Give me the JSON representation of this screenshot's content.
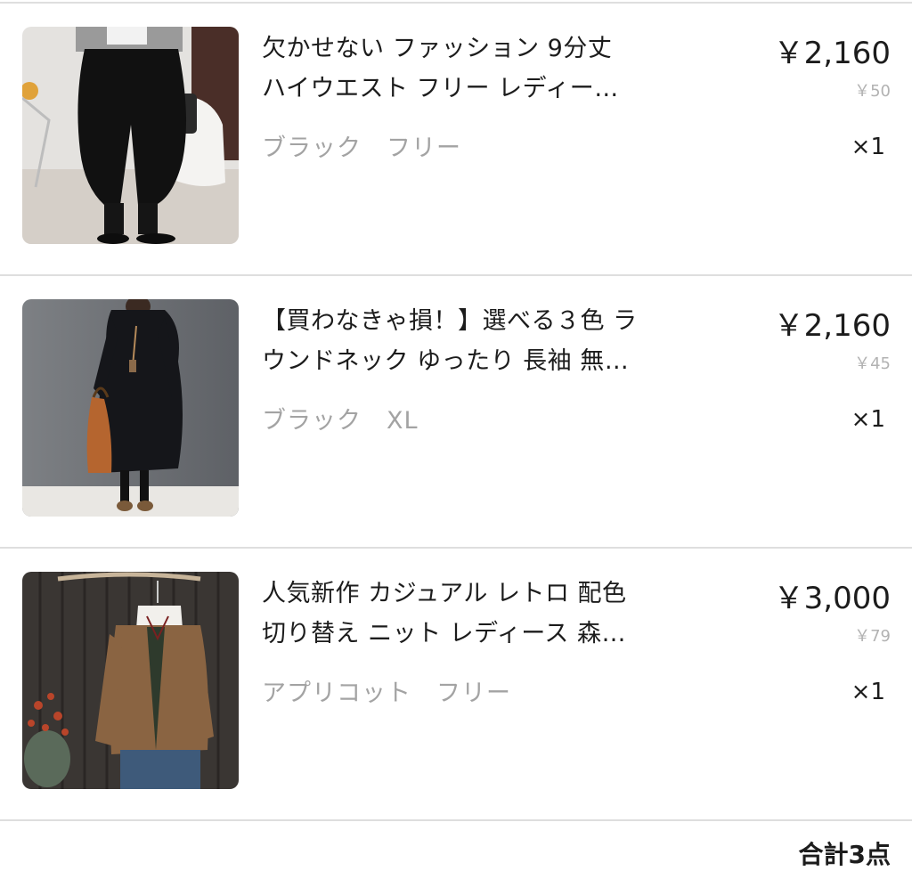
{
  "cart": {
    "items": [
      {
        "title_line1": "欠かせない ファッション 9分丈",
        "title_line2": "ハイウエスト フリー レディー…",
        "color": "ブラック",
        "size": "フリー",
        "price": "￥2,160",
        "points": "￥50",
        "quantity": "×1"
      },
      {
        "title_line1": "【買わなきゃ損！】選べる３色 ラ",
        "title_line2": "ウンドネック ゆったり 長袖 無…",
        "color": "ブラック",
        "size": "XL",
        "price": "￥2,160",
        "points": "￥45",
        "quantity": "×1"
      },
      {
        "title_line1": "人気新作 カジュアル レトロ 配色",
        "title_line2": "切り替え ニット レディース 森…",
        "color": "アプリコット",
        "size": "フリー",
        "price": "￥3,000",
        "points": "￥79",
        "quantity": "×1"
      }
    ],
    "total_label": "合計3点"
  }
}
